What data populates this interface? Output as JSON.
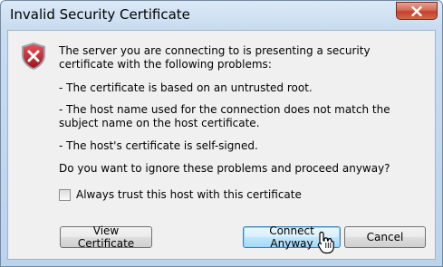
{
  "window": {
    "title": "Invalid Security Certificate"
  },
  "icons": {
    "close": "close-icon",
    "dialog": "security-warning-shield-icon"
  },
  "message": {
    "intro": "The server you are connecting to is presenting a security certificate with the following problems:",
    "problems": [
      "- The certificate is based on an untrusted root.",
      "- The host name used for the connection does not match the subject name on the host certificate.",
      "- The host's certificate is self-signed."
    ],
    "question": "Do you want to ignore these problems and proceed anyway?"
  },
  "options": {
    "always_trust_label": "Always trust this host with this certificate",
    "always_trust_checked": false
  },
  "buttons": {
    "view_certificate": "View Certificate",
    "connect_anyway": "Connect Anyway",
    "cancel": "Cancel"
  },
  "colors": {
    "title_bar": "#c9dcf0",
    "close_button": "#c2412a",
    "shield_red": "#c8202b",
    "focus_border": "#3c7fb1"
  }
}
